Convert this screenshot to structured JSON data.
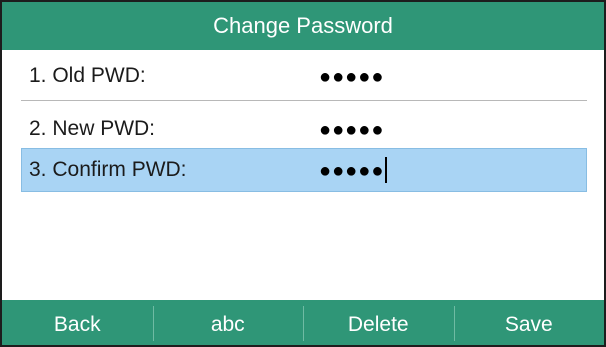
{
  "title": "Change Password",
  "fields": [
    {
      "label": "1. Old PWD:",
      "value": "●●●●●"
    },
    {
      "label": "2. New PWD:",
      "value": "●●●●●"
    },
    {
      "label": "3. Confirm PWD:",
      "value": "●●●●●"
    }
  ],
  "softkeys": {
    "back": "Back",
    "abc": "abc",
    "delete": "Delete",
    "save": "Save"
  },
  "colors": {
    "bar": "#2f9677",
    "selected_row": "#a9d4f4"
  }
}
